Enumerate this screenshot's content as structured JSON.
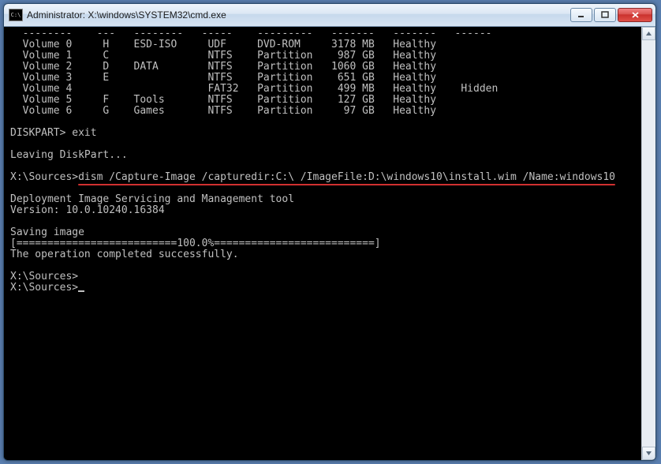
{
  "window": {
    "title": "Administrator: X:\\windows\\SYSTEM32\\cmd.exe"
  },
  "term": {
    "divider": "  --------    ---   --------   -----    ---------   -------   -------   ------",
    "vol0": "  Volume 0     H    ESD-ISO     UDF     DVD-ROM     3178 MB   Healthy",
    "vol1": "  Volume 1     C                NTFS    Partition    987 GB   Healthy",
    "vol2": "  Volume 2     D    DATA        NTFS    Partition   1060 GB   Healthy",
    "vol3": "  Volume 3     E                NTFS    Partition    651 GB   Healthy",
    "vol4": "  Volume 4                      FAT32   Partition    499 MB   Healthy    Hidden",
    "vol5": "  Volume 5     F    Tools       NTFS    Partition    127 GB   Healthy",
    "vol6": "  Volume 6     G    Games       NTFS    Partition     97 GB   Healthy",
    "dp_exit": "DISKPART> exit",
    "leaving": "Leaving DiskPart...",
    "dism_prompt": "X:\\Sources>",
    "dism_cmd": "dism /Capture-Image /capturedir:C:\\ /ImageFile:D:\\windows10\\install.wim /Name:windows10",
    "tool_line1": "Deployment Image Servicing and Management tool",
    "tool_line2": "Version: 10.0.10240.16384",
    "saving": "Saving image",
    "progress": "[==========================100.0%==========================]",
    "done": "The operation completed successfully.",
    "prompt1": "X:\\Sources>",
    "prompt2": "X:\\Sources>"
  }
}
